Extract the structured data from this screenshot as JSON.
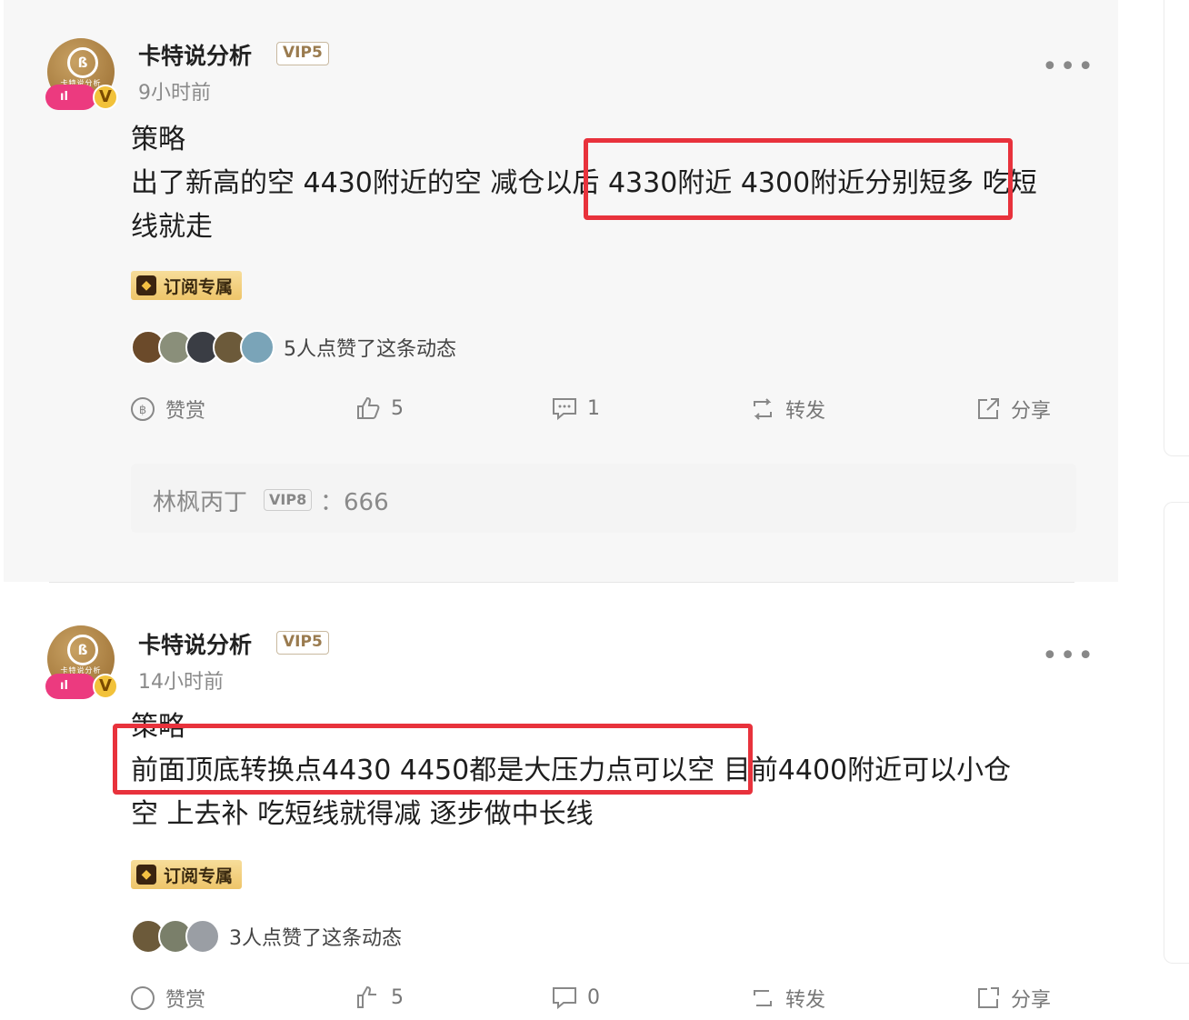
{
  "posts": [
    {
      "author": "卡特说分析",
      "vip": "VIP5",
      "time": "9小时前",
      "content_lines": [
        "策略",
        "出了新高的空 4430附近的空 减仓以后 4330附近  4300附近分别短多 吃短",
        "线就走"
      ],
      "badge": "订阅专属",
      "likes_text": "5人点赞了这条动态",
      "actions": {
        "reward": "赞赏",
        "like": "5",
        "comment": "1",
        "repost": "转发",
        "share": "分享"
      },
      "comment": {
        "name": "林枫丙丁",
        "vip": "VIP8",
        "separator": "：",
        "text": "666"
      }
    },
    {
      "author": "卡特说分析",
      "vip": "VIP5",
      "time": "14小时前",
      "content_lines": [
        "策略",
        "前面顶底转换点4430 4450都是大压力点可以空  目前4400附近可以小仓",
        "空 上去补 吃短线就得减  逐步做中长线"
      ],
      "badge": "订阅专属",
      "likes_text": "3人点赞了这条动态",
      "actions": {
        "reward": "赞赏",
        "like": "5",
        "comment": "0",
        "repost": "转发",
        "share": "分享"
      }
    }
  ],
  "avatar_label": "卡特说分析",
  "colors": {
    "highlight": "#e8323c",
    "live_badge": "#ec3a7f",
    "v_badge": "#f2c23a",
    "sub_badge": "#eec56a"
  },
  "icons": [
    "more-icon",
    "reward-icon",
    "thumb-up-icon",
    "comment-icon",
    "repost-icon",
    "share-icon",
    "gem-icon"
  ]
}
